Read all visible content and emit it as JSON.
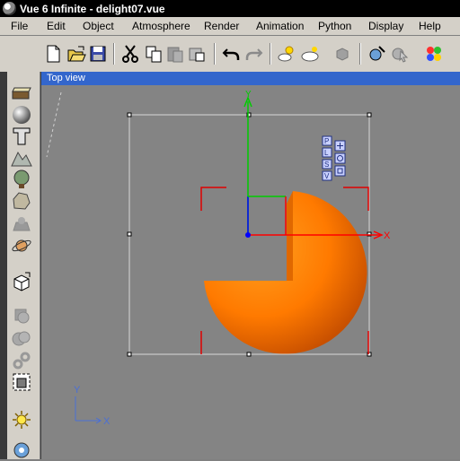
{
  "window": {
    "title": "Vue 6 Infinite - delight07.vue"
  },
  "menu": [
    {
      "key": "file",
      "label": "File"
    },
    {
      "key": "edit",
      "label": "Edit"
    },
    {
      "key": "object",
      "label": "Object"
    },
    {
      "key": "atmosphere",
      "label": "Atmosphere"
    },
    {
      "key": "render",
      "label": "Render"
    },
    {
      "key": "animation",
      "label": "Animation"
    },
    {
      "key": "python",
      "label": "Python"
    },
    {
      "key": "display",
      "label": "Display"
    },
    {
      "key": "help",
      "label": "Help"
    }
  ],
  "viewport": {
    "title": "Top view",
    "axis_x_label": "X",
    "axis_y_label": "Y",
    "corner_axis_x": "X",
    "corner_axis_y": "Y",
    "gizmo_buttons": [
      "P",
      "L",
      "S",
      "V"
    ]
  },
  "colors": {
    "title_bar": "#000000",
    "menu_bg": "#d4d0c8",
    "viewport_title_bg": "#3366cc",
    "viewport_bg": "#848484",
    "sphere": "#ff7a00",
    "axis_x": "#ff0000",
    "axis_y": "#00cc00",
    "axis_z": "#0000ff",
    "corner_axes": "#4a6fd6"
  },
  "icons": {
    "toolbar": [
      "new-file-icon",
      "open-file-icon",
      "save-icon",
      "cut-icon",
      "copy-icon",
      "paste-icon",
      "export-icon",
      "undo-icon",
      "redo-icon",
      "sun-cloud-icon",
      "clouds-icon",
      "object-icon",
      "edit-tools-icon",
      "pointer-icon",
      "palette-icon"
    ],
    "left": [
      "cube-icon",
      "sphere-icon",
      "text-icon",
      "terrain-icon",
      "plant-icon",
      "rock-icon",
      "cloud-layer-icon",
      "planet-icon",
      "3d-import-icon",
      "boolean-icon",
      "metablob-icon",
      "link-icon",
      "group-icon",
      "light-icon",
      "camera-icon"
    ]
  }
}
